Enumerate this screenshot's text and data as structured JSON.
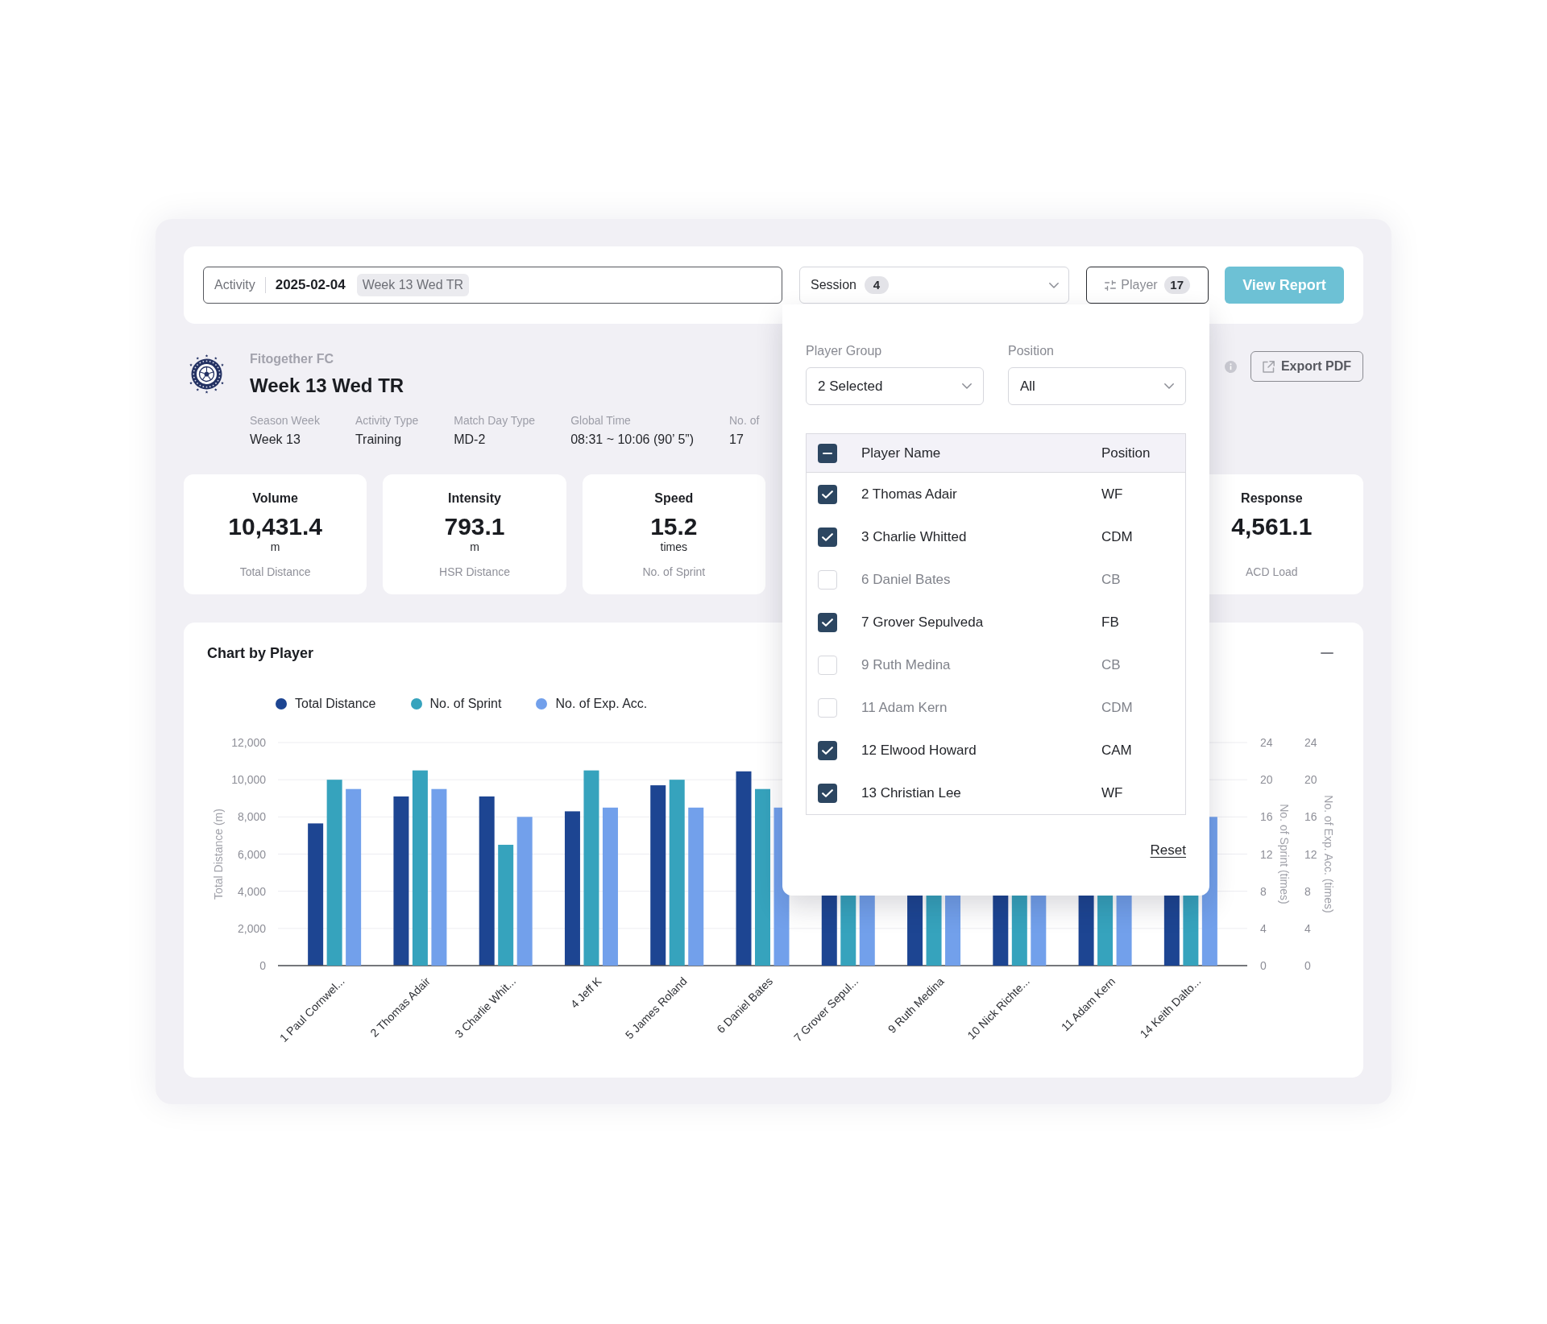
{
  "activity_bar": {
    "label": "Activity",
    "date": "2025-02-04",
    "tag": "Week 13 Wed TR"
  },
  "session": {
    "label": "Session",
    "count": "4"
  },
  "player_filter": {
    "label": "Player",
    "count": "17",
    "expanded": true,
    "panel": {
      "fields": [
        {
          "label": "Player Group",
          "value": "2 Selected"
        },
        {
          "label": "Position",
          "value": "All"
        }
      ],
      "table": {
        "columns": [
          "Player Name",
          "Position"
        ],
        "select_all": {
          "indeterminate": true
        },
        "rows": [
          {
            "name": "2 Thomas Adair",
            "position": "WF",
            "checked": true
          },
          {
            "name": "3 Charlie Whitted",
            "position": "CDM",
            "checked": true
          },
          {
            "name": "6 Daniel Bates",
            "position": "CB",
            "checked": false
          },
          {
            "name": "7 Grover Sepulveda",
            "position": "FB",
            "checked": true
          },
          {
            "name": "9 Ruth Medina",
            "position": "CB",
            "checked": false
          },
          {
            "name": "11 Adam Kern",
            "position": "CDM",
            "checked": false
          },
          {
            "name": "12 Elwood Howard",
            "position": "CAM",
            "checked": true
          },
          {
            "name": "13 Christian Lee",
            "position": "WF",
            "checked": true
          }
        ]
      },
      "reset": "Reset"
    }
  },
  "view_report": "View Report",
  "header": {
    "club": "Fitogether FC",
    "title": "Week 13 Wed TR",
    "meta": [
      {
        "label": "Season Week",
        "value": "Week 13"
      },
      {
        "label": "Activity Type",
        "value": "Training"
      },
      {
        "label": "Match Day Type",
        "value": "MD-2"
      },
      {
        "label": "Global Time",
        "value": "08:31 ~ 10:06 (90’ 5”)"
      },
      {
        "label": "No. of",
        "value": "17"
      }
    ],
    "export": "Export PDF"
  },
  "kpi_cards": [
    {
      "title": "Volume",
      "value": "10,431.4",
      "unit": "m",
      "label": "Total Distance"
    },
    {
      "title": "Intensity",
      "value": "793.1",
      "unit": "m",
      "label": "HSR Distance"
    },
    {
      "title": "Speed",
      "value": "15.2",
      "unit": "times",
      "label": "No. of Sprint"
    },
    {
      "title": "Response",
      "value": "4,561.1",
      "label": "ACD Load"
    }
  ],
  "chart": {
    "title": "Chart by Player",
    "layers": [
      {
        "chart_data": {
          "type": "bar",
          "categories": [
            "1 Paul Cornwel...",
            "2 Thomas Adair",
            "3 Charlie Whit...",
            "4 Jeff K",
            "5 James Roland",
            "6 Daniel Bates",
            "7 Grover Sepul...",
            "9 Ruth Medina",
            "10 Nick Richte...",
            "11 Adam Kern",
            "14 Keith Dalto..."
          ],
          "ylabel": "Total Distance (m)",
          "ylim": [
            0,
            12000
          ],
          "yticks": [
            {
              "value": 0,
              "label": "0"
            },
            {
              "value": 2000,
              "label": "2,000"
            },
            {
              "value": 4000,
              "label": "4,000"
            },
            {
              "value": 6000,
              "label": "6,000"
            },
            {
              "value": 8000,
              "label": "8,000"
            },
            {
              "value": 10000,
              "label": "10,000"
            },
            {
              "value": 12000,
              "label": "12,000"
            }
          ],
          "grid": true,
          "series": [
            {
              "name": "Total Distance",
              "color": "#1d4592",
              "values": [
                7650,
                9100,
                9100,
                8300,
                9700,
                10450,
                null,
                null,
                null,
                null,
                null
              ]
            }
          ]
        }
      },
      {
        "chart_data": {
          "type": "bar",
          "ylabel": "No. of Sprint (times)",
          "ylim": [
            0,
            24
          ],
          "yticks": [
            0,
            4,
            8,
            12,
            16,
            20,
            24
          ],
          "series": [
            {
              "name": "No. of Sprint",
              "color": "#36a3bd",
              "values": [
                20,
                21,
                13,
                21,
                20,
                19,
                null,
                null,
                null,
                null,
                null
              ]
            }
          ]
        }
      },
      {
        "chart_data": {
          "type": "bar",
          "ylabel": "No. of Exp. Acc. (times)",
          "ylim": [
            0,
            24
          ],
          "yticks": [
            0,
            4,
            8,
            12,
            16,
            20,
            24
          ],
          "series": [
            {
              "name": "No. of Exp. Acc.",
              "color": "#72a0eb",
              "values": [
                19,
                19,
                16,
                17,
                17,
                17,
                null,
                null,
                null,
                null,
                16
              ]
            }
          ]
        }
      }
    ]
  }
}
